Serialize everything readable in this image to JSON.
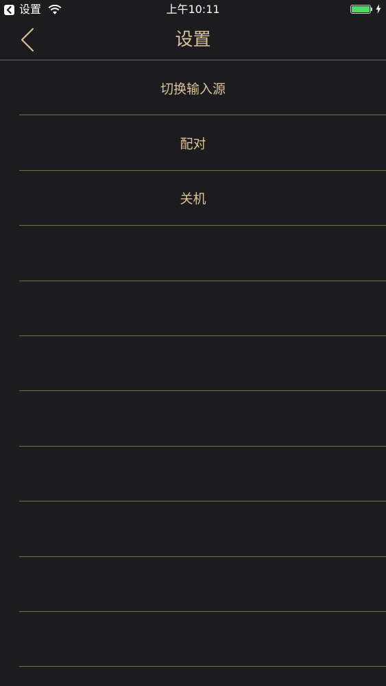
{
  "status_bar": {
    "back_app_label": "设置",
    "time": "上午10:11",
    "battery_level": 1.0
  },
  "nav": {
    "title": "设置",
    "back_icon": "chevron-left-icon"
  },
  "menu": {
    "items": [
      {
        "label": "切换输入源"
      },
      {
        "label": "配对"
      },
      {
        "label": "关机"
      }
    ],
    "empty_rows": 8
  },
  "colors": {
    "background": "#1c1b1d",
    "accent": "#d8c39a",
    "divider": "#7c6f52",
    "battery": "#4cd964"
  }
}
